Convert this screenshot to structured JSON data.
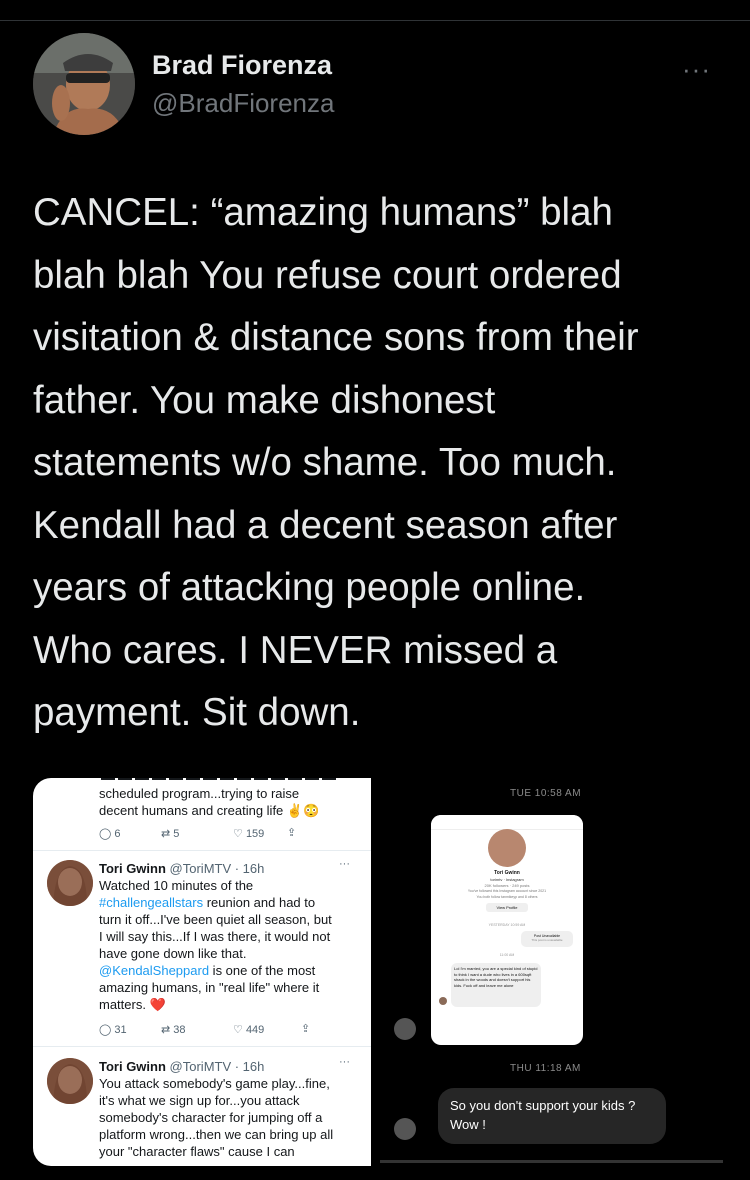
{
  "tweet": {
    "author_name": "Brad Fiorenza",
    "author_handle": "@BradFiorenza",
    "more_label": "···",
    "text": "CANCEL: “amazing humans” blah\nblah blah You refuse court ordered\nvisitation & distance sons from their\nfather. You make dishonest\nstatements w/o shame. Too much.\nKendall had a decent season after\nyears of attacking people online.\nWho cares. I NEVER missed a\npayment. Sit down."
  },
  "left_screenshot": {
    "top_snippet": "scheduled program...trying to raise\ndecent humans and creating life ✌️😳",
    "top_actions": {
      "replies": "6",
      "retweets": "5",
      "likes": "159"
    },
    "tweet1": {
      "name": "Tori Gwinn",
      "meta": "@ToriMTV · 16h",
      "text_a": "Watched 10 minutes of the",
      "hashtag": "#challengeallstars",
      "text_b": " reunion and had to\nturn it off...I've been quiet all season, but\nI will say this...If I was there, it would not\nhave gone down like that.",
      "mention": "@KendalSheppard",
      "text_c": " is one of the most\namazing humans, in \"real life\" where it\nmatters. ❤️",
      "replies": "31",
      "retweets": "38",
      "likes": "449"
    },
    "tweet2": {
      "name": "Tori Gwinn",
      "meta": "@ToriMTV · 16h",
      "text": "You attack somebody's game play...fine,\nit's what we sign up for...you attack\nsomebody's character for jumping off a\nplatform wrong...then we can bring up all\nyour \"character flaws\" cause I can"
    }
  },
  "right_screenshot": {
    "time1": "TUE 10:58 AM",
    "profile_name": "Tori Gwinn",
    "profile_sub": "torimtv · Instagram",
    "profile_stats": "20K followers · 249 posts",
    "profile_note1": "You've followed this Instagram account since 2021",
    "profile_note2": "You both follow tanmikeyp and 8 others",
    "view_profile": "View Profile",
    "inner_time": "YESTERDAY 10:59 AM",
    "post_unavailable": "Post Unavailable",
    "post_unavailable_sub": "This post is unavailable",
    "inner_time2": "11:00 AM",
    "inner_msg": "Lol I'm married, you are a special kind of stupid to think I want a dude who lives in a 600sqft shack in the woods and doesn't support his kids. Fuck off and leave me alone",
    "time2": "THU 11:18 AM",
    "message": "So you don't support your kids ?\nWow !"
  },
  "colors": {
    "background": "#000000",
    "text": "#e7e9ea",
    "muted": "#71767b",
    "link": "#1d9bf0",
    "bubble": "#262626"
  }
}
